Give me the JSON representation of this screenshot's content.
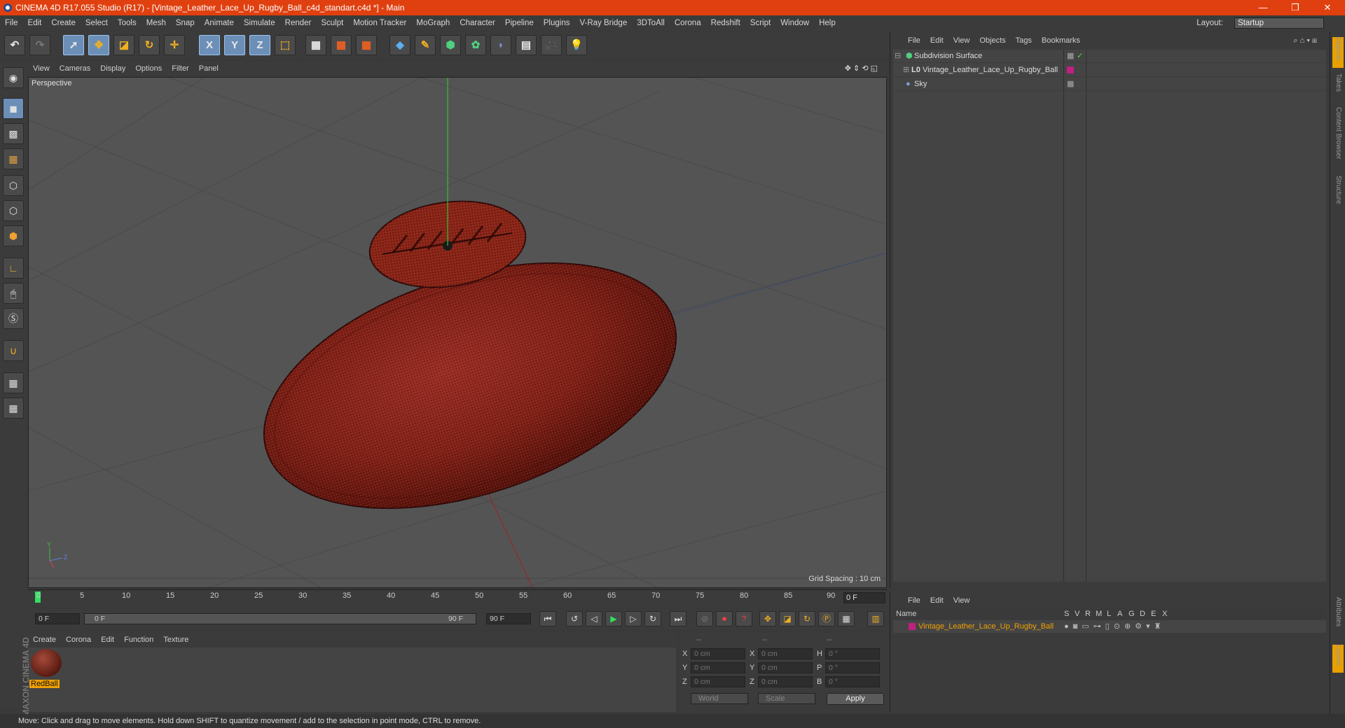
{
  "title": "CINEMA 4D R17.055 Studio (R17) - [Vintage_Leather_Lace_Up_Rugby_Ball_c4d_standart.c4d *] - Main",
  "window_controls": {
    "minimize": "—",
    "maximize": "❐",
    "close": "✕"
  },
  "menu": [
    "File",
    "Edit",
    "Create",
    "Select",
    "Tools",
    "Mesh",
    "Snap",
    "Animate",
    "Simulate",
    "Render",
    "Sculpt",
    "Motion Tracker",
    "MoGraph",
    "Character",
    "Pipeline",
    "Plugins",
    "V-Ray Bridge",
    "3DToAll",
    "Corona",
    "Redshift",
    "Script",
    "Window",
    "Help"
  ],
  "layout": {
    "label": "Layout:",
    "value": "Startup"
  },
  "toolbar": {
    "x": "X",
    "y": "Y",
    "z": "Z"
  },
  "viewport": {
    "menu": [
      "View",
      "Cameras",
      "Display",
      "Options",
      "Filter",
      "Panel"
    ],
    "label": "Perspective",
    "grid_spacing": "Grid Spacing : 10 cm"
  },
  "timeline": {
    "ticks": [
      "0",
      "5",
      "10",
      "15",
      "20",
      "25",
      "30",
      "35",
      "40",
      "45",
      "50",
      "55",
      "60",
      "65",
      "70",
      "75",
      "80",
      "85",
      "90"
    ],
    "current_frame": "0 F",
    "start": "0 F",
    "range_start": "0 F",
    "range_end": "90 F",
    "end": "90 F"
  },
  "material_manager": {
    "menu": [
      "Create",
      "Corona",
      "Edit",
      "Function",
      "Texture"
    ],
    "material_name": "RedBall"
  },
  "coordinates": {
    "headers": [
      "--",
      "--",
      "--"
    ],
    "rows": [
      {
        "l1": "X",
        "v1": "0 cm",
        "l2": "X",
        "v2": "0 cm",
        "l3": "H",
        "v3": "0 °"
      },
      {
        "l1": "Y",
        "v1": "0 cm",
        "l2": "Y",
        "v2": "0 cm",
        "l3": "P",
        "v3": "0 °"
      },
      {
        "l1": "Z",
        "v1": "0 cm",
        "l2": "Z",
        "v2": "0 cm",
        "l3": "B",
        "v3": "0 °"
      }
    ],
    "world": "World",
    "scale": "Scale",
    "apply": "Apply"
  },
  "object_manager": {
    "menu": [
      "File",
      "Edit",
      "View",
      "Objects",
      "Tags",
      "Bookmarks"
    ],
    "objects": [
      "Subdivision Surface",
      "Vintage_Leather_Lace_Up_Rugby_Ball",
      "Sky"
    ]
  },
  "layer_manager": {
    "menu": [
      "File",
      "Edit",
      "View"
    ],
    "columns": [
      "Name",
      "S",
      "V",
      "R",
      "M",
      "L",
      "A",
      "G",
      "D",
      "E",
      "X"
    ],
    "layer_name": "Vintage_Leather_Lace_Up_Rugby_Ball"
  },
  "side_tabs": [
    "Objects",
    "Takes",
    "Content Browser",
    "Structure",
    "Attributes",
    "Layers"
  ],
  "logo": "MAXON CINEMA 4D",
  "status": "Move: Click and drag to move elements. Hold down SHIFT to quantize movement / add to the selection in point mode, CTRL to remove.",
  "colors": {
    "title_bar": "#e0400f",
    "accent": "#f0a000",
    "highlight": "#6c8fb8",
    "ball": "#8a2418"
  }
}
